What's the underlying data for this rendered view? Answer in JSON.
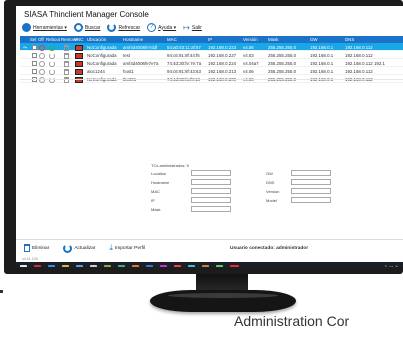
{
  "app": {
    "title": "SIASA Thinclient Manager Console"
  },
  "toolbar": {
    "herramientas": "Herramientas ▾",
    "buscar": "Buscar",
    "refrescar": "Refrescar",
    "ayuda": "Ayuda ▾",
    "salir": "Salir"
  },
  "grid": {
    "headers": [
      "Sel",
      "Off",
      "Reboot",
      "Remove",
      "VNC",
      "Ubicación",
      "Hostname",
      "MAC",
      "IP",
      "Versión",
      "Mask",
      "GW",
      "DNS"
    ],
    "rows": [
      {
        "ubicacion": "NoConfigurada",
        "hostname": "amf4d4006fe7ddf",
        "mac": "54:a0:63:11:af:67",
        "ip": "192.168.0.223",
        "version": "v4.06",
        "mask": "255.255.255.0",
        "gw": "192.168.0.1",
        "dns": "192.168.0.112",
        "power": "on",
        "reboot": "on"
      },
      {
        "ubicacion": "NoConfigurada",
        "hostname": "test",
        "mac": "94:c6:91:8f:44:f6",
        "ip": "192.168.0.227",
        "version": "v4.03",
        "mask": "255.255.255.0",
        "gw": "192.168.0.1",
        "dns": "192.168.0.112",
        "power": "off",
        "reboot": "off"
      },
      {
        "ubicacion": "NoConfigurada",
        "hostname": "amf4d4006fe7e7a",
        "mac": "74:4d:30:fe:7e:7a",
        "ip": "192.168.0.224",
        "version": "v4.04a7",
        "mask": "255.255.255.0",
        "gw": "192.168.0.1",
        "dns": "192.168.0.112 192.1",
        "power": "off",
        "reboot": "off"
      },
      {
        "ubicacion": "aloc1244",
        "hostname": "host1",
        "mac": "94:c6:91:8f:43:63",
        "ip": "192.168.0.213",
        "version": "v4.06",
        "mask": "255.255.255.0",
        "gw": "192.168.0.1",
        "dns": "192.168.0.112",
        "power": "off",
        "reboot": "off"
      },
      {
        "ubicacion": "NoConfigurada",
        "hostname": "tbx001",
        "mac": "74:4d:30:fa:f8:18",
        "ip": "192.168.0.209",
        "version": "v4.06",
        "mask": "255.255.255.0",
        "gw": "192.168.0.1",
        "dns": "192.168.0.112",
        "power": "off",
        "reboot": "off"
      }
    ]
  },
  "details": {
    "count_label": "TCs administrados: 5",
    "location": "Location",
    "hostname": "Hostname",
    "mac": "MAC",
    "ip": "IP",
    "mask": "Mask",
    "gw": "GW",
    "dns": "DNS",
    "version": "Version",
    "model": "Model"
  },
  "bottom": {
    "eliminar": "Eliminar",
    "actualizar": "Actualizar",
    "importar": "Importar Perfil",
    "user": "Usuario conectado: administrador",
    "version": "v4.01.109"
  },
  "caption": "Administration Cor",
  "colors": {
    "header": "#1b73c8",
    "selected_row": "#1aa7e8",
    "taskbar": "#1b1f2a"
  }
}
